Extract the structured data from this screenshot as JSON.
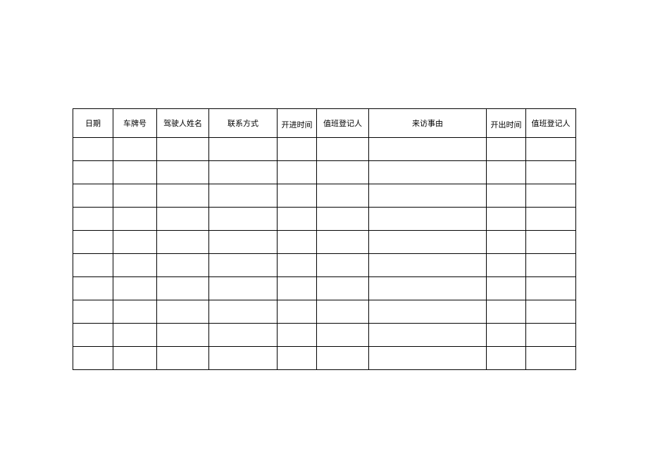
{
  "table": {
    "headers": [
      "日期",
      "车牌号",
      "驾驶人姓名",
      "联系方式",
      "开进时间",
      "值班登记人",
      "来访事由",
      "开出时间",
      "值班登记人"
    ],
    "row_count": 10
  }
}
